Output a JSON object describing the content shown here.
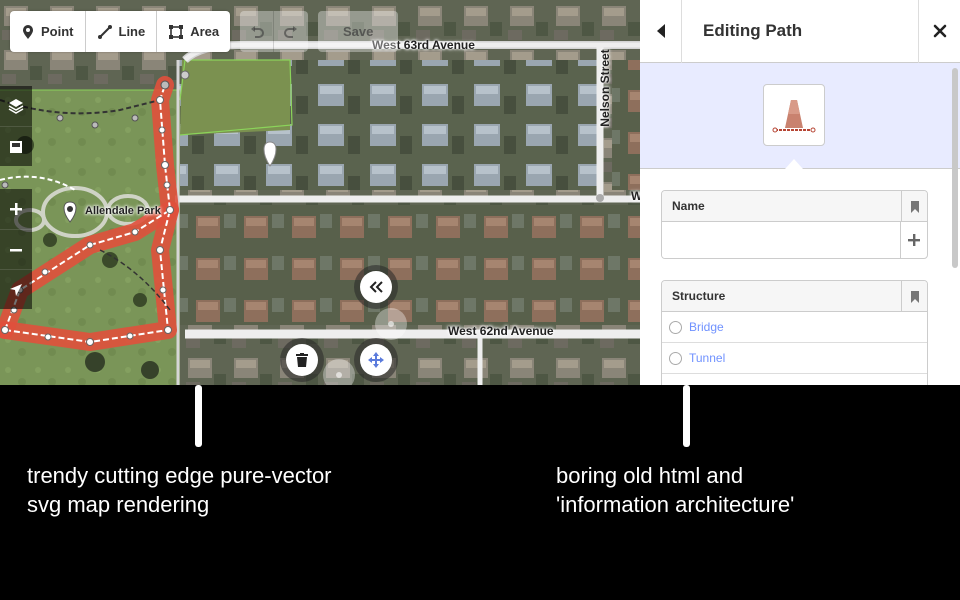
{
  "toolbar": {
    "modes": [
      {
        "label": "Point",
        "icon": "map-marker-icon"
      },
      {
        "label": "Line",
        "icon": "line-icon"
      },
      {
        "label": "Area",
        "icon": "area-icon"
      }
    ],
    "save_label": "Save"
  },
  "map": {
    "streets": {
      "west_63rd": "West 63rd Avenue",
      "west_62nd": "West 62nd Avenue",
      "nelson": "Nelson Street",
      "right_edge": "W"
    },
    "poi_label": "Allendale Park",
    "colors": {
      "path_highlight": "#e0503c",
      "park_boundary": "#8bd45a"
    }
  },
  "sidebar": {
    "title": "Editing Path",
    "fields": {
      "name": {
        "label": "Name",
        "value": ""
      },
      "structure": {
        "label": "Structure",
        "options": [
          "Bridge",
          "Tunnel"
        ]
      }
    },
    "colors": {
      "preset_bg": "#e8ebff",
      "link": "#7092ff"
    }
  },
  "captions": {
    "left": [
      "trendy cutting edge pure-vector",
      "svg map rendering"
    ],
    "right": [
      "boring old html and",
      "'information architecture'"
    ]
  }
}
